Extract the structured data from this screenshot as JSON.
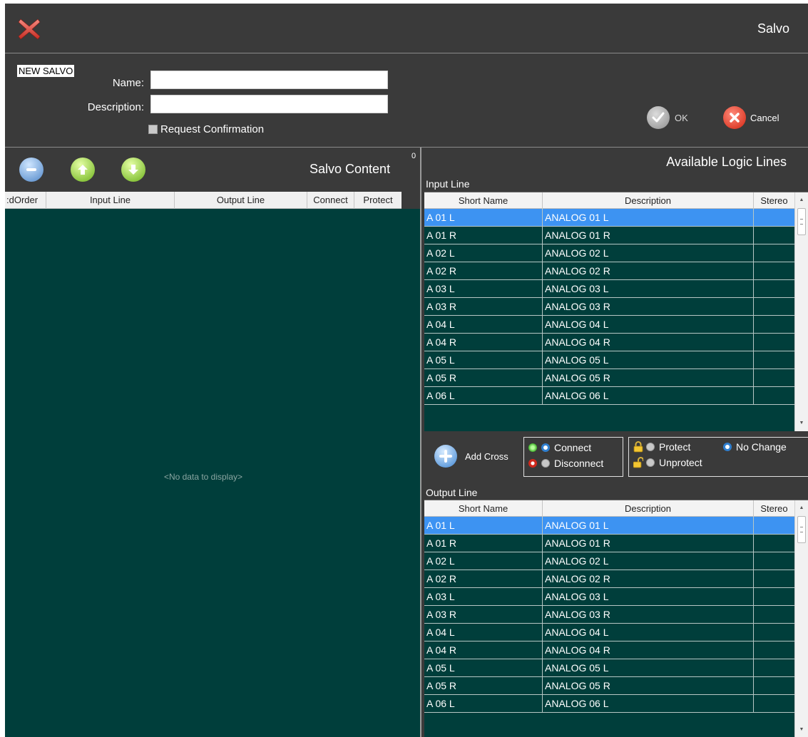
{
  "window": {
    "title": "Salvo"
  },
  "form": {
    "badge": "NEW SALVO",
    "name_label": "Name:",
    "name_value": "",
    "description_label": "Description:",
    "description_value": "",
    "confirm_label": "Request Confirmation",
    "confirm_checked": false,
    "ok_label": "OK",
    "cancel_label": "Cancel"
  },
  "salvo_content": {
    "title": "Salvo Content",
    "count": "0",
    "columns": [
      ":dOrder",
      "Input Line",
      "Output Line",
      "Connect",
      "Protect"
    ],
    "empty_text": "<No data to display>"
  },
  "available": {
    "title": "Available Logic Lines",
    "columns": [
      "Short Name",
      "Description",
      "Stereo"
    ],
    "input": {
      "title": "Input Line",
      "rows": [
        {
          "short": "A 01 L",
          "desc": "ANALOG 01 L",
          "stereo": ""
        },
        {
          "short": "A 01 R",
          "desc": "ANALOG 01 R",
          "stereo": ""
        },
        {
          "short": "A 02 L",
          "desc": "ANALOG 02 L",
          "stereo": ""
        },
        {
          "short": "A 02 R",
          "desc": "ANALOG 02 R",
          "stereo": ""
        },
        {
          "short": "A 03 L",
          "desc": "ANALOG 03 L",
          "stereo": ""
        },
        {
          "short": "A 03 R",
          "desc": "ANALOG 03 R",
          "stereo": ""
        },
        {
          "short": "A 04 L",
          "desc": "ANALOG 04 L",
          "stereo": ""
        },
        {
          "short": "A 04 R",
          "desc": "ANALOG 04 R",
          "stereo": ""
        },
        {
          "short": "A 05 L",
          "desc": "ANALOG 05 L",
          "stereo": ""
        },
        {
          "short": "A 05 R",
          "desc": "ANALOG 05 R",
          "stereo": ""
        },
        {
          "short": "A 06 L",
          "desc": "ANALOG 06 L",
          "stereo": ""
        }
      ]
    },
    "output": {
      "title": "Output Line",
      "rows": [
        {
          "short": "A 01 L",
          "desc": "ANALOG 01 L",
          "stereo": ""
        },
        {
          "short": "A 01 R",
          "desc": "ANALOG 01 R",
          "stereo": ""
        },
        {
          "short": "A 02 L",
          "desc": "ANALOG 02 L",
          "stereo": ""
        },
        {
          "short": "A 02 R",
          "desc": "ANALOG 02 R",
          "stereo": ""
        },
        {
          "short": "A 03 L",
          "desc": "ANALOG 03 L",
          "stereo": ""
        },
        {
          "short": "A 03 R",
          "desc": "ANALOG 03 R",
          "stereo": ""
        },
        {
          "short": "A 04 L",
          "desc": "ANALOG 04 L",
          "stereo": ""
        },
        {
          "short": "A 04 R",
          "desc": "ANALOG 04 R",
          "stereo": ""
        },
        {
          "short": "A 05 L",
          "desc": "ANALOG 05 L",
          "stereo": ""
        },
        {
          "short": "A 05 R",
          "desc": "ANALOG 05 R",
          "stereo": ""
        },
        {
          "short": "A 06 L",
          "desc": "ANALOG 06 L",
          "stereo": ""
        }
      ]
    },
    "selected_row_index": 0
  },
  "cross": {
    "add_label": "Add Cross",
    "connect_label": "Connect",
    "disconnect_label": "Disconnect",
    "connect_selected": "connect",
    "protect_label": "Protect",
    "unprotect_label": "Unprotect",
    "nochange_label": "No Change",
    "protect_selected": "nochange"
  },
  "icons": {
    "close": "close-x-icon",
    "ok": "check-icon",
    "cancel": "cancel-x-icon",
    "remove": "minus-icon",
    "move_up": "arrow-up-icon",
    "move_down": "arrow-down-icon",
    "add_cross": "plus-icon",
    "lock": "lock-icon",
    "unlock": "unlock-icon"
  },
  "colors": {
    "accent_selected_row": "#3d93f2",
    "grid_background": "#003e3b",
    "chrome": "#3a3a3a",
    "close_red": "#e2463a"
  }
}
